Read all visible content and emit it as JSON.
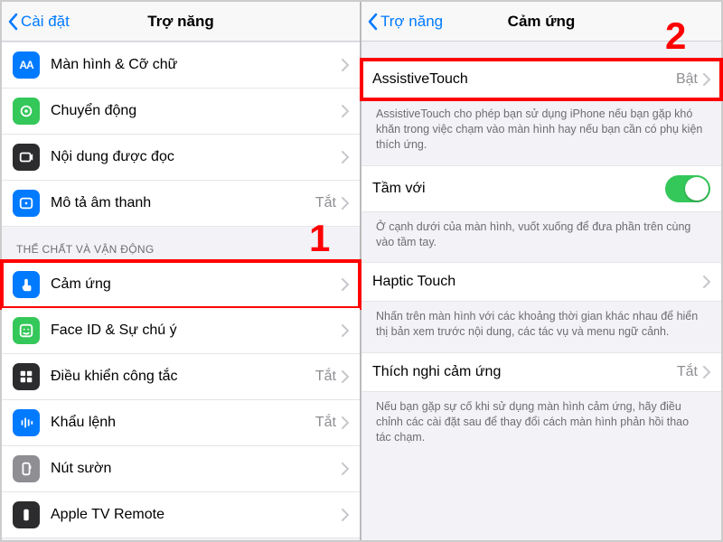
{
  "left": {
    "back": "Cài đặt",
    "title": "Trợ năng",
    "group1_header": "",
    "items1": [
      {
        "icon": "AA",
        "bg": "#007aff",
        "label": "Màn hình & Cỡ chữ",
        "val": ""
      },
      {
        "icon": "motion",
        "bg": "#34c759",
        "label": "Chuyển động",
        "val": ""
      },
      {
        "icon": "speech",
        "bg": "#2c2c2e",
        "label": "Nội dung được đọc",
        "val": ""
      },
      {
        "icon": "ad",
        "bg": "#007aff",
        "label": "Mô tả âm thanh",
        "val": "Tắt"
      }
    ],
    "group2_header": "THỂ CHẤT VÀ VẬN ĐỘNG",
    "items2": [
      {
        "icon": "touch",
        "bg": "#007aff",
        "label": "Cảm ứng",
        "val": "",
        "hl": true
      },
      {
        "icon": "face",
        "bg": "#34c759",
        "label": "Face ID & Sự chú ý",
        "val": ""
      },
      {
        "icon": "switch",
        "bg": "#2c2c2e",
        "label": "Điều khiển công tắc",
        "val": "Tắt"
      },
      {
        "icon": "voice",
        "bg": "#007aff",
        "label": "Khẩu lệnh",
        "val": "Tắt"
      },
      {
        "icon": "side",
        "bg": "#8e8e93",
        "label": "Nút sườn",
        "val": ""
      },
      {
        "icon": "atv",
        "bg": "#2c2c2e",
        "label": "Apple TV Remote",
        "val": ""
      }
    ],
    "annot": "1"
  },
  "right": {
    "back": "Trợ năng",
    "title": "Cảm ứng",
    "items": [
      {
        "label": "AssistiveTouch",
        "val": "Bật",
        "hl": true,
        "footer": "AssistiveTouch cho phép bạn sử dụng iPhone nếu bạn gặp khó khăn trong việc chạm vào màn hình hay nếu bạn cần có phụ kiện thích ứng."
      },
      {
        "label": "Tầm với",
        "toggle": true,
        "footer": "Ở cạnh dưới của màn hình, vuốt xuống để đưa phần trên cùng vào tầm tay."
      },
      {
        "label": "Haptic Touch",
        "val": "",
        "footer": "Nhấn trên màn hình với các khoảng thời gian khác nhau để hiển thị bản xem trước nội dung, các tác vụ và menu ngữ cảnh."
      },
      {
        "label": "Thích nghi cảm ứng",
        "val": "Tắt",
        "footer": "Nếu bạn gặp sự cố khi sử dụng màn hình cảm ứng, hãy điều chỉnh các cài đặt sau để thay đổi cách màn hình phản hồi thao tác chạm."
      }
    ],
    "annot": "2"
  }
}
